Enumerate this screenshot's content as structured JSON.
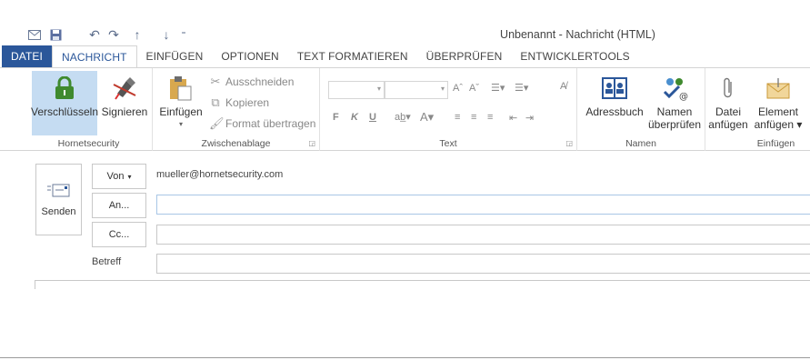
{
  "window": {
    "title": "Unbenannt - Nachricht (HTML)"
  },
  "quick_access": {
    "icons": [
      "outlook-icon",
      "save-icon",
      "undo-icon",
      "redo-icon",
      "up-arrow-icon",
      "down-arrow-icon",
      "customize-qat-icon"
    ]
  },
  "tabs": [
    "DATEI",
    "NACHRICHT",
    "EINFÜGEN",
    "OPTIONEN",
    "TEXT FORMATIEREN",
    "ÜBERPRÜFEN",
    "ENTWICKLERTOOLS"
  ],
  "active_tab": "NACHRICHT",
  "ribbon": {
    "hornetsecurity": {
      "label": "Hornetsecurity",
      "encrypt": "Verschlüsseln",
      "sign": "Signieren"
    },
    "clipboard": {
      "label": "Zwischenablage",
      "paste": "Einfügen",
      "cut": "Ausschneiden",
      "copy": "Kopieren",
      "format_painter": "Format übertragen"
    },
    "text": {
      "label": "Text",
      "bold": "F",
      "italic": "K",
      "underline": "U"
    },
    "names": {
      "label": "Namen",
      "address_book": "Adressbuch",
      "check_names_1": "Namen",
      "check_names_2": "überprüfen"
    },
    "insert": {
      "label": "Einfügen",
      "attach_file_1": "Datei",
      "attach_file_2": "anfügen",
      "attach_item_1": "Element",
      "attach_item_2": "anfügen"
    }
  },
  "compose": {
    "send": "Senden",
    "from_button": "Von",
    "from_value": "mueller@hornetsecurity.com",
    "to_button": "An...",
    "cc_button": "Cc...",
    "subject_label": "Betreff",
    "to_value": "",
    "cc_value": "",
    "subject_value": ""
  },
  "colors": {
    "file_tab": "#2b579a",
    "accent_text": "#2b579a",
    "selected_button": "#c5dcf2",
    "lock_green": "#3f8a2e"
  }
}
